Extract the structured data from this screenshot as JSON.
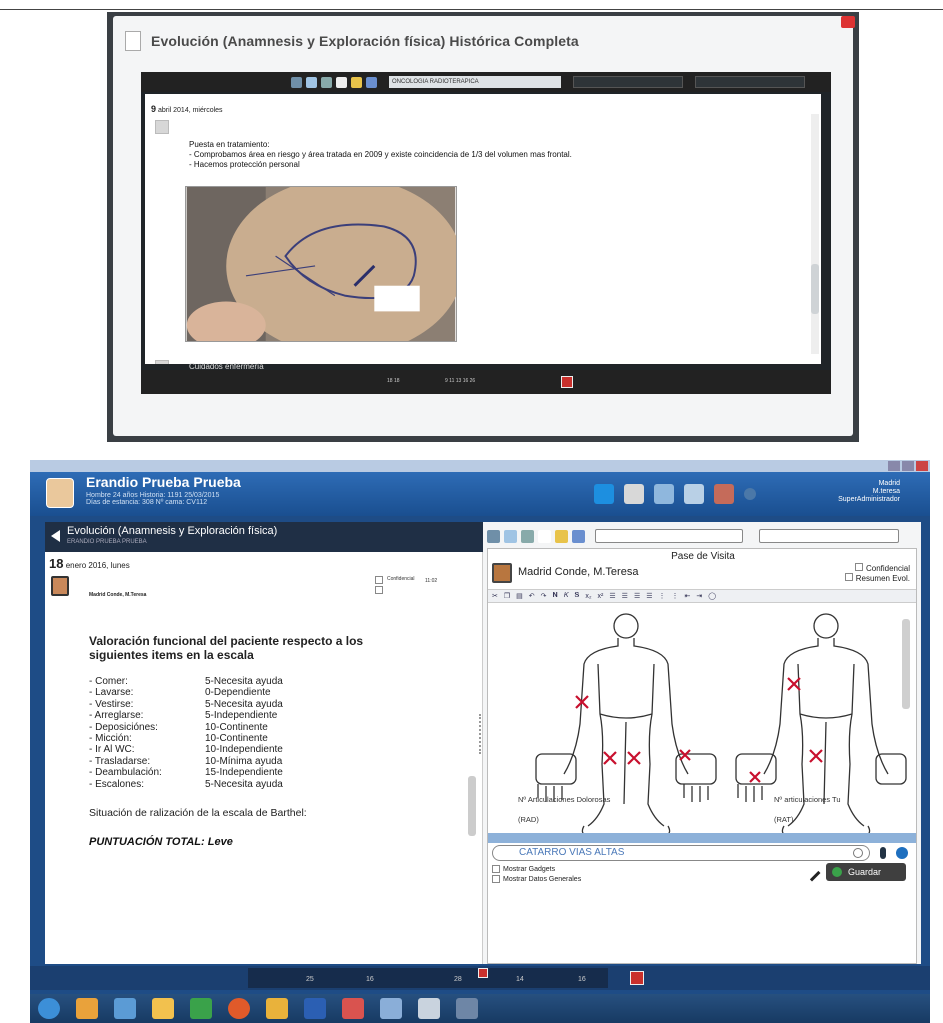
{
  "shot1": {
    "dialog_title": "Evolución (Anamnesis y Exploración física) Histórica Completa",
    "toolbar_select": "ONCOLOGIA RADIOTERAPICA",
    "date_day": "9",
    "date_rest": "abril 2014, miércoles",
    "note_lines": [
      "Puesta en tratamiento:",
      "- Comprobamos área en riesgo y área tratada en 2009 y existe coincidencia de 1/3 del volumen mas frontal.",
      "- Hacemos protección personal"
    ],
    "second_entry": "Cuidados enfermería",
    "timeline_numbers": [
      "18 18",
      "9 11 13 16 26"
    ]
  },
  "shot2": {
    "patient_name": "Erandio Prueba Prueba",
    "patient_line1": "Hombre 24 años Historia: 1191 25/03/2015",
    "patient_line2": "Días de estancia: 308 Nº cama: CV112",
    "user_location": "Madrid",
    "user_name": "M.teresa",
    "user_role": "SuperAdministrador",
    "left_header_title": "Evolución (Anamnesis y Exploración física)",
    "left_header_sub": "ERANDIO PRUEBA PRUEBA",
    "date_day": "18",
    "date_rest": "enero 2016, lunes",
    "doctor": "Madrid Conde, M.Teresa",
    "confidencial": "Confidencial",
    "time": "11:02",
    "assessment_title_1": "Valoración funcional del paciente respecto a los",
    "assessment_title_2": "siguientes items en la escala",
    "items": [
      {
        "k": "- Comer:",
        "v": "5-Necesita ayuda"
      },
      {
        "k": "- Lavarse:",
        "v": "0-Dependiente"
      },
      {
        "k": "- Vestirse:",
        "v": "5-Necesita ayuda"
      },
      {
        "k": "- Arreglarse:",
        "v": "5-Independiente"
      },
      {
        "k": "- Deposiciónes:",
        "v": "10-Continente"
      },
      {
        "k": "- Micción:",
        "v": "10-Continente"
      },
      {
        "k": "- Ir Al WC:",
        "v": "10-Independiente"
      },
      {
        "k": "- Trasladarse:",
        "v": "10-Mínima ayuda"
      },
      {
        "k": "- Deambulación:",
        "v": "15-Independiente"
      },
      {
        "k": "- Escalones:",
        "v": "5-Necesita ayuda"
      }
    ],
    "situation": "Situación de ralización de la escala de Barthel:",
    "total": "PUNTUACIÓN TOTAL: Leve",
    "right_title": "Pase de Visita",
    "right_doctor": "Madrid Conde, M.Teresa",
    "right_confidencial": "Confidencial",
    "right_resumen": "Resumen Evol.",
    "label_dolorosas": "Nº Articulaciones Dolorosas",
    "label_tu": "Nº articulaciones Tu",
    "rad": "(RAD)",
    "rat": "(RAT)",
    "diag_search": "CATARRO VIAS ALTAS",
    "mostrar_gadgets": "Mostrar Gadgets",
    "mostrar_datos": "Mostrar Datos Generales",
    "save_label": "Guardar",
    "timeline": [
      "25",
      "16",
      "28",
      "14",
      "16"
    ]
  },
  "colors": {
    "header_blue": "#2e6cb6",
    "dark_panel": "#1f2f45",
    "joint_mark": "#c8102e",
    "save_green": "#3aa24a"
  }
}
